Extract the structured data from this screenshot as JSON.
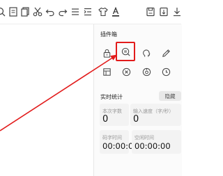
{
  "toolbar": {
    "icons": [
      "search-icon",
      "document-icon",
      "copy-icon",
      "cut-icon",
      "undo-icon",
      "redo-icon",
      "list-icon",
      "indent-icon",
      "shirt-icon",
      "font-color-icon",
      "save-icon",
      "save-as-icon",
      "download-icon"
    ]
  },
  "plugins": {
    "title": "插件箱",
    "icons": [
      "lock-icon",
      "search-document-icon",
      "head-icon",
      "pencil-icon",
      "table-icon",
      "circle-x-icon",
      "circle-at-icon",
      "clock-icon"
    ]
  },
  "stats": {
    "title": "实时统计",
    "hide_label": "隐藏",
    "char_count_label": "本次字数",
    "char_count_value": "0",
    "speed_label": "输入速度（字/秒）",
    "speed_value": "0",
    "typing_time_label": "码字时间",
    "typing_time_value": "00:00:00",
    "idle_time_label": "空闲时间",
    "idle_time_value": "00:00:00"
  },
  "colors": {
    "highlight": "#e21b1b",
    "accent": "#333333"
  }
}
